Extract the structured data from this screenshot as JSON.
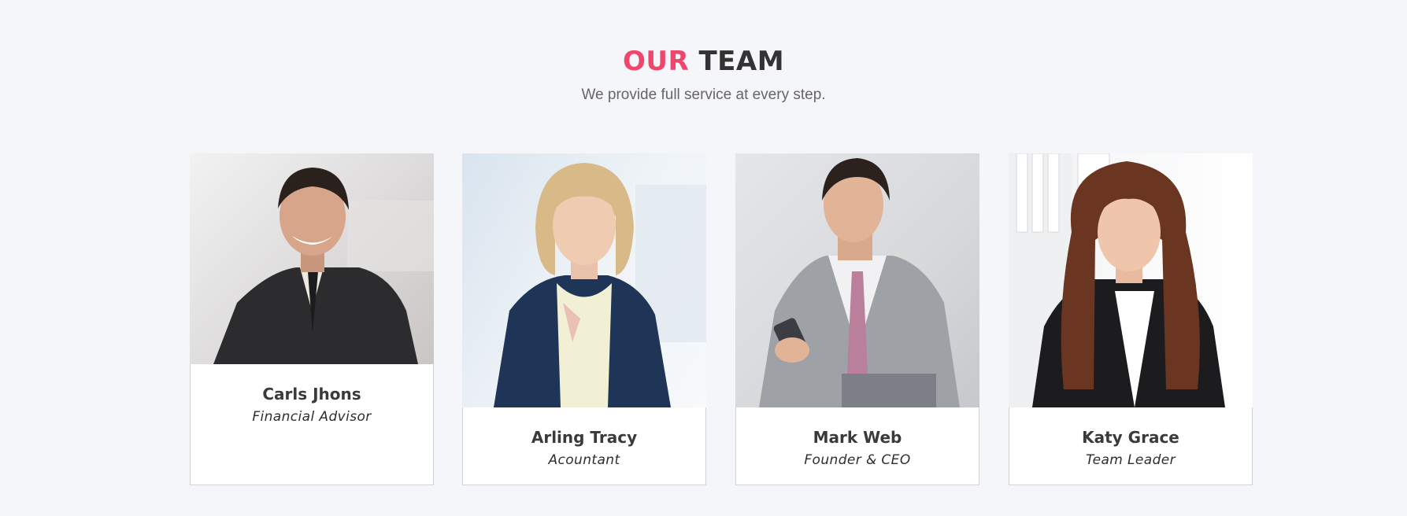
{
  "header": {
    "title_accent": "OUR",
    "title_main": "TEAM",
    "subtitle": "We provide full service at every step."
  },
  "colors": {
    "accent": "#f0466b",
    "heading": "#333333",
    "background": "#f5f6fa"
  },
  "team": [
    {
      "name": "Carls Jhons",
      "role": "Financial Advisor"
    },
    {
      "name": "Arling Tracy",
      "role": "Acountant"
    },
    {
      "name": "Mark Web",
      "role": "Founder & CEO"
    },
    {
      "name": "Katy Grace",
      "role": "Team Leader"
    }
  ]
}
